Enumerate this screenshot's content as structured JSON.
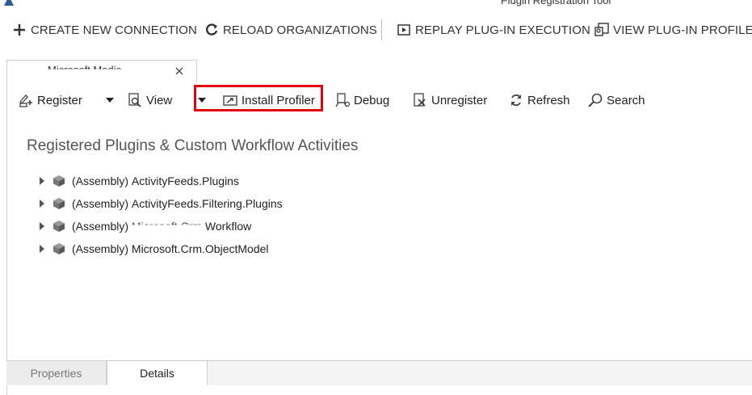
{
  "window": {
    "title": "Plugin Registration Tool"
  },
  "main_toolbar": {
    "create": "CREATE NEW CONNECTION",
    "reload": "RELOAD ORGANIZATIONS",
    "replay": "REPLAY PLUG-IN EXECUTION",
    "view_profile": "VIEW PLUG-IN PROFILE"
  },
  "document_tab": {
    "label": "Microsoft Media"
  },
  "toolbar": {
    "register": "Register",
    "view": "View",
    "install_profiler": "Install Profiler",
    "debug": "Debug",
    "unregister": "Unregister",
    "refresh": "Refresh",
    "search": "Search"
  },
  "section": {
    "title": "Registered Plugins & Custom Workflow Activities"
  },
  "assemblies": [
    {
      "prefix": "(Assembly)",
      "name": "ActivityFeeds.Plugins"
    },
    {
      "prefix": "(Assembly)",
      "name": "ActivityFeeds.Filtering.Plugins"
    },
    {
      "prefix": "(Assembly)",
      "obscured": "Microsoft.Crm.",
      "name": "Workflow"
    },
    {
      "prefix": "(Assembly)",
      "name": "Microsoft.Crm.ObjectModel"
    }
  ],
  "bottom_tabs": {
    "properties": "Properties",
    "details": "Details"
  },
  "colors": {
    "highlight": "#e0000f",
    "icon": "#555555"
  }
}
